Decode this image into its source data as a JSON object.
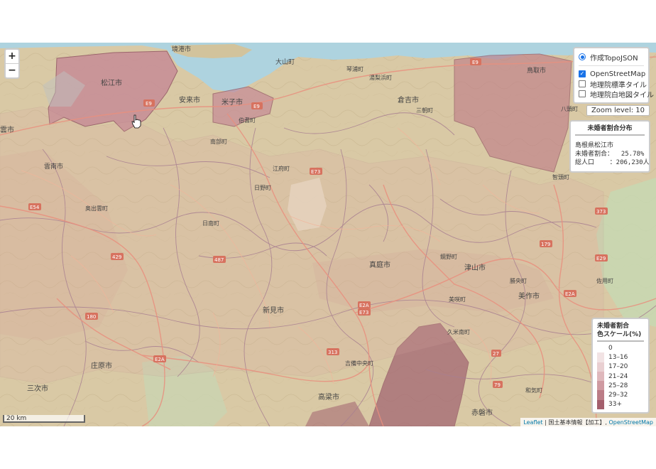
{
  "map": {
    "place_labels": [
      {
        "text": "境港市"
      },
      {
        "text": "大山町"
      },
      {
        "text": "鳥取市"
      },
      {
        "text": "松江市"
      },
      {
        "text": "安来市"
      },
      {
        "text": "米子市"
      },
      {
        "text": "倉吉市"
      },
      {
        "text": "雲南市"
      },
      {
        "text": "江府町"
      },
      {
        "text": "日野町"
      },
      {
        "text": "奥出雲町"
      },
      {
        "text": "日南町"
      },
      {
        "text": "新見市"
      },
      {
        "text": "真庭市"
      },
      {
        "text": "津山市"
      },
      {
        "text": "美作市"
      },
      {
        "text": "庄原市"
      },
      {
        "text": "三次市"
      },
      {
        "text": "高梁市"
      },
      {
        "text": "赤磐市"
      },
      {
        "text": "智頭町"
      },
      {
        "text": "鏡野町"
      },
      {
        "text": "久米南町"
      },
      {
        "text": "和気町"
      },
      {
        "text": "吉備中央町"
      },
      {
        "text": "湯梨浜町"
      },
      {
        "text": "三朝町"
      },
      {
        "text": "伯耆町"
      },
      {
        "text": "南部町"
      },
      {
        "text": "八頭町"
      },
      {
        "text": "雲市"
      },
      {
        "text": "佐用町"
      },
      {
        "text": "勝央町"
      },
      {
        "text": "美咲町"
      },
      {
        "text": "琴浦町"
      }
    ],
    "road_badges": [
      "E9",
      "E9",
      "E9",
      "E73",
      "E54",
      "E2A",
      "E2A",
      "E73",
      "E29",
      "E2A",
      "373",
      "179",
      "429",
      "27",
      "79",
      "E2",
      "487",
      "313",
      "180"
    ]
  },
  "zoom_control": {
    "zoom_in": "+",
    "zoom_out": "−"
  },
  "layer_control": {
    "overlay": {
      "label": "作成TopoJSON",
      "selected": true
    },
    "base": [
      {
        "label": "OpenStreetMap",
        "checked": true
      },
      {
        "label": "地理院標準タイル",
        "checked": false
      },
      {
        "label": "地理院白地図タイル",
        "checked": false
      }
    ]
  },
  "zoom_level_text": "Zoom level: 10",
  "info_box": {
    "title": "未婚者割合分布",
    "area": "島根県松江市",
    "ratio_line": "未婚者割合：  25.78%",
    "population_line": "総人口    ：206,230人"
  },
  "legend": {
    "title_line1": "未婚者割合",
    "title_line2": "色スケール(%)",
    "items": [
      {
        "label": "0",
        "color": "#ffffff"
      },
      {
        "label": "13–16",
        "color": "#f2e3e4"
      },
      {
        "label": "17–20",
        "color": "#e9cfd1"
      },
      {
        "label": "21–24",
        "color": "#dfb8bc"
      },
      {
        "label": "25–28",
        "color": "#cf9aa1"
      },
      {
        "label": "29–32",
        "color": "#bb7c86"
      },
      {
        "label": "33+",
        "color": "#a45f6d"
      }
    ]
  },
  "scale_bar": "20 km",
  "attribution": {
    "leaflet": "Leaflet",
    "sep": " | ",
    "gsi": "国土基本情報【加工】",
    "comma": ", ",
    "osm": "OpenStreetMap"
  }
}
